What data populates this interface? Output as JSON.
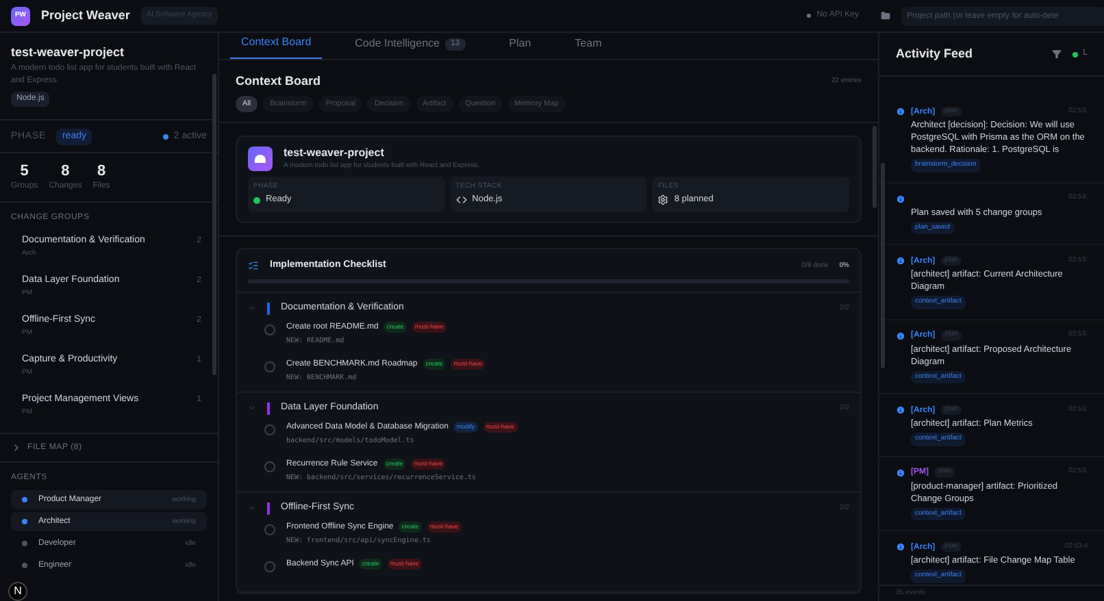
{
  "header": {
    "logo": "PW",
    "title": "Project Weaver",
    "badge": "AI Software Agency",
    "api_status": "No API Key",
    "path_placeholder": "Project path (or leave empty for auto-dete"
  },
  "sidebar": {
    "project": {
      "name": "test-weaver-project",
      "description": "A modern todo list app for students built with React and Express.",
      "tag": "Node.js"
    },
    "phase_label": "PHASE",
    "phase": "ready",
    "active": "2 active",
    "stats": [
      {
        "value": "5",
        "label": "Groups"
      },
      {
        "value": "8",
        "label": "Changes"
      },
      {
        "value": "8",
        "label": "Files"
      }
    ],
    "change_groups_title": "CHANGE GROUPS",
    "change_groups": [
      {
        "name": "Documentation & Verification",
        "owner": "Arch",
        "count": "2"
      },
      {
        "name": "Data Layer Foundation",
        "owner": "PM",
        "count": "2"
      },
      {
        "name": "Offline-First Sync",
        "owner": "PM",
        "count": "2"
      },
      {
        "name": "Capture & Productivity",
        "owner": "PM",
        "count": "1"
      },
      {
        "name": "Project Management Views",
        "owner": "PM",
        "count": "1"
      }
    ],
    "file_map": {
      "label": "FILE MAP (8)",
      "expanded": false
    },
    "agents_title": "AGENTS",
    "agents": [
      {
        "name": "Product Manager",
        "status": "working",
        "active": true
      },
      {
        "name": "Architect",
        "status": "working",
        "active": true
      },
      {
        "name": "Developer",
        "status": "idle",
        "active": false
      },
      {
        "name": "Engineer",
        "status": "idle",
        "active": false
      }
    ],
    "dev_badge": "N"
  },
  "tabs": [
    {
      "label": "Context Board",
      "selected": true
    },
    {
      "label": "Code Intelligence",
      "count": "13",
      "selected": false
    },
    {
      "label": "Plan",
      "selected": false
    },
    {
      "label": "Team",
      "selected": false
    }
  ],
  "board": {
    "title": "Context Board",
    "entries": "22 entries",
    "filters": [
      {
        "label": "All",
        "selected": true
      },
      {
        "label": "Brainstorm",
        "selected": false
      },
      {
        "label": "Proposal",
        "selected": false
      },
      {
        "label": "Decision",
        "selected": false
      },
      {
        "label": "Artifact",
        "selected": false
      },
      {
        "label": "Question",
        "selected": false
      },
      {
        "label": "Memory Map",
        "selected": false
      }
    ],
    "project_card": {
      "name": "test-weaver-project",
      "description": "A modern todo list app for students built with React and Express.",
      "facts": [
        {
          "kind": "phase",
          "label": "PHASE",
          "value": "Ready"
        },
        {
          "kind": "stack",
          "label": "TECH STACK",
          "value": "Node.js"
        },
        {
          "kind": "files",
          "label": "FILES",
          "value": "8 planned"
        }
      ]
    },
    "checklist": {
      "title": "Implementation Checklist",
      "done": "0/8 done",
      "percent": "0%",
      "level": 0,
      "groups": [
        {
          "name": "Documentation & Verification",
          "color": "#2563eb",
          "count": "0/2",
          "expanded": true,
          "items": [
            {
              "title": "Create root README.md",
              "action": "create",
              "priority": "must-have",
              "path": "NEW: README.md",
              "checked": false
            },
            {
              "title": "Create BENCHMARK.md Roadmap",
              "action": "create",
              "priority": "must-have",
              "path": "NEW: BENCHMARK.md",
              "checked": false
            }
          ]
        },
        {
          "name": "Data Layer Foundation",
          "color": "#9333ea",
          "count": "0/2",
          "expanded": true,
          "items": [
            {
              "title": "Advanced Data Model & Database Migration",
              "action": "modify",
              "priority": "must-have",
              "path": "backend/src/models/todoModel.ts",
              "checked": false
            },
            {
              "title": "Recurrence Rule Service",
              "action": "create",
              "priority": "must-have",
              "path": "NEW: backend/src/services/recurrenceService.ts",
              "checked": false
            }
          ]
        },
        {
          "name": "Offline-First Sync",
          "color": "#9333ea",
          "count": "0/2",
          "expanded": true,
          "items": [
            {
              "title": "Frontend Offline Sync Engine",
              "action": "create",
              "priority": "must-have",
              "path": "NEW: frontend/src/api/syncEngine.ts",
              "checked": false
            },
            {
              "title": "Backend Sync API",
              "action": "create",
              "priority": "must-have",
              "checked": false
            }
          ]
        }
      ]
    }
  },
  "feed": {
    "title": "Activity Feed",
    "live": "L",
    "events": [
      {
        "agent": "[Arch]",
        "color": "#3b82f6",
        "phase": "plan",
        "time": "02:53:",
        "text": "Architect [decision]: Decision: We will use PostgreSQL with Prisma as the ORM on the backend. Rationale: 1. PostgreSQL is",
        "tag": "brainstorm_decision"
      },
      {
        "time": "02:53:",
        "text": "Plan saved with 5 change groups",
        "tag": "plan_saved"
      },
      {
        "agent": "[Arch]",
        "color": "#3b82f6",
        "phase": "plan",
        "time": "02:53:",
        "text": "[architect] artifact: Current Architecture Diagram",
        "tag": "context_artifact"
      },
      {
        "agent": "[Arch]",
        "color": "#3b82f6",
        "phase": "plan",
        "time": "02:53:",
        "text": "[architect] artifact: Proposed Architecture Diagram",
        "tag": "context_artifact"
      },
      {
        "agent": "[Arch]",
        "color": "#3b82f6",
        "phase": "plan",
        "time": "02:53:",
        "text": "[architect] artifact: Plan Metrics",
        "tag": "context_artifact"
      },
      {
        "agent": "[PM]",
        "color": "#a855f7",
        "phase": "plan",
        "time": "02:53:",
        "text": "[product-manager] artifact: Prioritized Change Groups",
        "tag": "context_artifact"
      },
      {
        "agent": "[Arch]",
        "color": "#3b82f6",
        "phase": "plan",
        "time": "02:53:4",
        "text": "[architect] artifact: File Change Map Table",
        "tag": "context_artifact"
      }
    ],
    "footer": "35 events"
  }
}
